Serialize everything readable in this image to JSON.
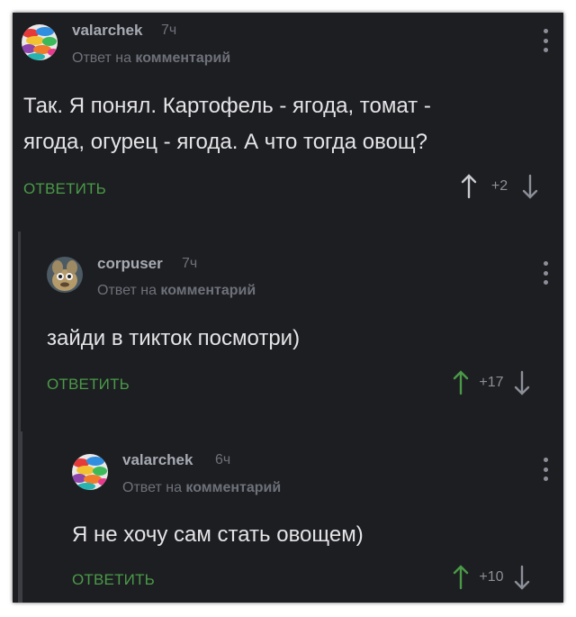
{
  "comments": [
    {
      "author": "valarchek",
      "time": "7ч",
      "reply_prefix": "Ответ на",
      "reply_target": "комментарий",
      "text": "Так. Я понял. Картофель - ягода, томат - ягода, огурец - ягода. А что тогда овощ?",
      "text_lines": [
        "Так. Я понял. Картофель - ягода, томат -",
        "ягода, огурец - ягода. А что тогда овощ?"
      ],
      "reply_label": "ОТВЕТИТЬ",
      "score": "+2",
      "avatar": "colorful-umbrellas-avatar"
    },
    {
      "author": "corpuser",
      "time": "7ч",
      "reply_prefix": "Ответ на",
      "reply_target": "комментарий",
      "text": "зайди в тикток посмотри)",
      "reply_label": "ОТВЕТИТЬ",
      "score": "+17",
      "avatar": "cartoon-character-avatar"
    },
    {
      "author": "valarchek",
      "time": "6ч",
      "reply_prefix": "Ответ на",
      "reply_target": "комментарий",
      "text": "Я не хочу сам стать овощем)",
      "reply_label": "ОТВЕТИТЬ",
      "score": "+10",
      "avatar": "colorful-umbrellas-avatar"
    }
  ],
  "colors": {
    "background": "#1d1e22",
    "text": "#e4e4e6",
    "reply_button": "#4a9a47",
    "upvote_active": "#4a9a47",
    "muted": "#6e717a",
    "thread_line": "#3c3e44"
  },
  "icons": {
    "upvote": "arrow-up-icon",
    "downvote": "arrow-down-icon",
    "menu": "more-vertical-icon"
  }
}
